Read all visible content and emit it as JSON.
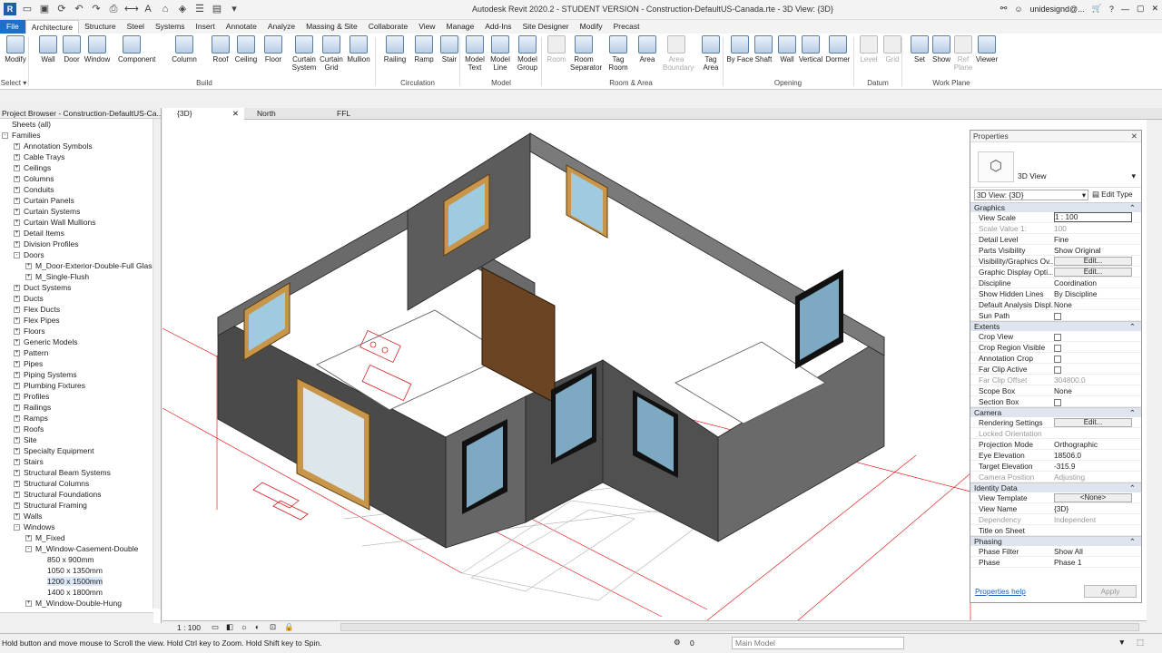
{
  "app": {
    "title": "Autodesk Revit 2020.2 - STUDENT VERSION - Construction-DefaultUS-Canada.rte - 3D View: {3D}",
    "user": "unidesignd@...",
    "search": "search-icon"
  },
  "tabs": [
    "File",
    "Architecture",
    "Structure",
    "Steel",
    "Systems",
    "Insert",
    "Annotate",
    "Analyze",
    "Massing & Site",
    "Collaborate",
    "View",
    "Manage",
    "Add-Ins",
    "Site Designer",
    "Modify",
    "Precast"
  ],
  "active_tab": "Architecture",
  "ribbon": {
    "select_label": "Select",
    "tools": [
      "Modify",
      "Wall",
      "Door",
      "Window",
      "Component",
      "Column",
      "Roof",
      "Ceiling",
      "Floor",
      "Curtain System",
      "Curtain Grid",
      "Mullion",
      "Railing",
      "Ramp",
      "Stair",
      "Model Text",
      "Model Line",
      "Model Group",
      "Room",
      "Room Separator",
      "Tag Room",
      "Area",
      "Area Boundary",
      "Tag Area",
      "By Face",
      "Shaft",
      "Wall",
      "Vertical",
      "Dormer",
      "Level",
      "Grid",
      "Set",
      "Show",
      "Ref Plane",
      "Viewer"
    ],
    "panels": [
      "Build",
      "Circulation",
      "Model",
      "Room & Area",
      "Opening",
      "Datum",
      "Work Plane"
    ]
  },
  "project_browser": {
    "title": "Project Browser - Construction-DefaultUS-Ca...",
    "items": [
      {
        "label": "Sheets (all)",
        "level": 0,
        "toggle": ""
      },
      {
        "label": "Families",
        "level": 0,
        "toggle": "-"
      },
      {
        "label": "Annotation Symbols",
        "level": 1,
        "toggle": "+"
      },
      {
        "label": "Cable Trays",
        "level": 1,
        "toggle": "+"
      },
      {
        "label": "Ceilings",
        "level": 1,
        "toggle": "+"
      },
      {
        "label": "Columns",
        "level": 1,
        "toggle": "+"
      },
      {
        "label": "Conduits",
        "level": 1,
        "toggle": "+"
      },
      {
        "label": "Curtain Panels",
        "level": 1,
        "toggle": "+"
      },
      {
        "label": "Curtain Systems",
        "level": 1,
        "toggle": "+"
      },
      {
        "label": "Curtain Wall Mullions",
        "level": 1,
        "toggle": "+"
      },
      {
        "label": "Detail Items",
        "level": 1,
        "toggle": "+"
      },
      {
        "label": "Division Profiles",
        "level": 1,
        "toggle": "+"
      },
      {
        "label": "Doors",
        "level": 1,
        "toggle": "-"
      },
      {
        "label": "M_Door-Exterior-Double-Full Glass",
        "level": 2,
        "toggle": "+"
      },
      {
        "label": "M_Single-Flush",
        "level": 2,
        "toggle": "+"
      },
      {
        "label": "Duct Systems",
        "level": 1,
        "toggle": "+"
      },
      {
        "label": "Ducts",
        "level": 1,
        "toggle": "+"
      },
      {
        "label": "Flex Ducts",
        "level": 1,
        "toggle": "+"
      },
      {
        "label": "Flex Pipes",
        "level": 1,
        "toggle": "+"
      },
      {
        "label": "Floors",
        "level": 1,
        "toggle": "+"
      },
      {
        "label": "Generic Models",
        "level": 1,
        "toggle": "+"
      },
      {
        "label": "Pattern",
        "level": 1,
        "toggle": "+"
      },
      {
        "label": "Pipes",
        "level": 1,
        "toggle": "+"
      },
      {
        "label": "Piping Systems",
        "level": 1,
        "toggle": "+"
      },
      {
        "label": "Plumbing Fixtures",
        "level": 1,
        "toggle": "+"
      },
      {
        "label": "Profiles",
        "level": 1,
        "toggle": "+"
      },
      {
        "label": "Railings",
        "level": 1,
        "toggle": "+"
      },
      {
        "label": "Ramps",
        "level": 1,
        "toggle": "+"
      },
      {
        "label": "Roofs",
        "level": 1,
        "toggle": "+"
      },
      {
        "label": "Site",
        "level": 1,
        "toggle": "+"
      },
      {
        "label": "Specialty Equipment",
        "level": 1,
        "toggle": "+"
      },
      {
        "label": "Stairs",
        "level": 1,
        "toggle": "+"
      },
      {
        "label": "Structural Beam Systems",
        "level": 1,
        "toggle": "+"
      },
      {
        "label": "Structural Columns",
        "level": 1,
        "toggle": "+"
      },
      {
        "label": "Structural Foundations",
        "level": 1,
        "toggle": "+"
      },
      {
        "label": "Structural Framing",
        "level": 1,
        "toggle": "+"
      },
      {
        "label": "Walls",
        "level": 1,
        "toggle": "+"
      },
      {
        "label": "Windows",
        "level": 1,
        "toggle": "-"
      },
      {
        "label": "M_Fixed",
        "level": 2,
        "toggle": "+"
      },
      {
        "label": "M_Window-Casement-Double",
        "level": 2,
        "toggle": "-"
      },
      {
        "label": "850 x 900mm",
        "level": 3,
        "toggle": ""
      },
      {
        "label": "1050 x 1350mm",
        "level": 3,
        "toggle": ""
      },
      {
        "label": "1200 x 1500mm",
        "level": 3,
        "toggle": "",
        "selected": true
      },
      {
        "label": "1400 x 1800mm",
        "level": 3,
        "toggle": ""
      },
      {
        "label": "M_Window-Double-Hung",
        "level": 2,
        "toggle": "+"
      },
      {
        "label": "Groups",
        "level": 0,
        "toggle": "+"
      }
    ]
  },
  "view_tabs": [
    {
      "label": "{3D}",
      "active": true
    },
    {
      "label": "North",
      "active": false
    },
    {
      "label": "FFL",
      "active": false
    }
  ],
  "properties": {
    "title": "Properties",
    "type_name": "3D View",
    "instance": "3D View: {3D}",
    "edit_type": "Edit Type",
    "groups": [
      {
        "name": "Graphics",
        "rows": [
          {
            "k": "View Scale",
            "v": "1 : 100"
          },
          {
            "k": "Scale Value    1:",
            "v": "100",
            "dim": true
          },
          {
            "k": "Detail Level",
            "v": "Fine"
          },
          {
            "k": "Parts Visibility",
            "v": "Show Original"
          },
          {
            "k": "Visibility/Graphics Ov...",
            "v": "Edit...",
            "btn": true
          },
          {
            "k": "Graphic Display Opti...",
            "v": "Edit...",
            "btn": true
          },
          {
            "k": "Discipline",
            "v": "Coordination"
          },
          {
            "k": "Show Hidden Lines",
            "v": "By Discipline"
          },
          {
            "k": "Default Analysis Displ...",
            "v": "None"
          },
          {
            "k": "Sun Path",
            "v": "",
            "cb": true
          }
        ]
      },
      {
        "name": "Extents",
        "rows": [
          {
            "k": "Crop View",
            "v": "",
            "cb": true
          },
          {
            "k": "Crop Region Visible",
            "v": "",
            "cb": true
          },
          {
            "k": "Annotation Crop",
            "v": "",
            "cb": true
          },
          {
            "k": "Far Clip Active",
            "v": "",
            "cb": true
          },
          {
            "k": "Far Clip Offset",
            "v": "304800.0",
            "dim": true
          },
          {
            "k": "Scope Box",
            "v": "None"
          },
          {
            "k": "Section Box",
            "v": "",
            "cb": true
          }
        ]
      },
      {
        "name": "Camera",
        "rows": [
          {
            "k": "Rendering Settings",
            "v": "Edit...",
            "btn": true
          },
          {
            "k": "Locked Orientation",
            "v": "",
            "dim": true
          },
          {
            "k": "Projection Mode",
            "v": "Orthographic"
          },
          {
            "k": "Eye Elevation",
            "v": "18506.0"
          },
          {
            "k": "Target Elevation",
            "v": "-315.9"
          },
          {
            "k": "Camera Position",
            "v": "Adjusting",
            "dim": true
          }
        ]
      },
      {
        "name": "Identity Data",
        "rows": [
          {
            "k": "View Template",
            "v": "<None>",
            "btn": true
          },
          {
            "k": "View Name",
            "v": "{3D}"
          },
          {
            "k": "Dependency",
            "v": "Independent",
            "dim": true
          },
          {
            "k": "Title on Sheet",
            "v": ""
          }
        ]
      },
      {
        "name": "Phasing",
        "rows": [
          {
            "k": "Phase Filter",
            "v": "Show All"
          },
          {
            "k": "Phase",
            "v": "Phase 1"
          }
        ]
      }
    ],
    "help": "Properties help",
    "apply": "Apply"
  },
  "view_bar": {
    "scale": "1 : 100"
  },
  "status": {
    "text": "Hold button and move mouse to Scroll the view. Hold Ctrl key to Zoom. Hold Shift key to Spin.",
    "model": "Main Model",
    "counter": "0"
  }
}
